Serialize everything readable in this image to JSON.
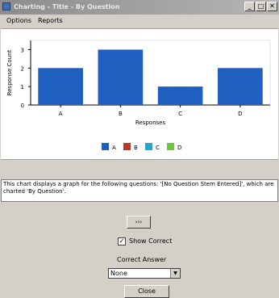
{
  "window": {
    "title": "Charting - Title - By Question",
    "buttons": {
      "minimize": "_",
      "maximize": "□",
      "close": "✕"
    }
  },
  "menubar": {
    "items": [
      "Options",
      "Reports"
    ]
  },
  "chart_data": {
    "type": "bar",
    "categories": [
      "A",
      "B",
      "C",
      "D"
    ],
    "values": [
      2,
      3,
      1,
      2
    ],
    "xlabel": "Responses",
    "ylabel": "Response Count",
    "yticks": [
      0,
      1,
      2,
      3
    ],
    "ylim": [
      0,
      3.5
    ],
    "grid": false,
    "legend": {
      "placement": "bottom",
      "entries": [
        {
          "label": "A",
          "color": "#1f5fbf"
        },
        {
          "label": "B",
          "color": "#c8321e"
        },
        {
          "label": "C",
          "color": "#2aa4c8"
        },
        {
          "label": "D",
          "color": "#6cc832"
        }
      ]
    },
    "bar_color": "#1f5fbf"
  },
  "description": "This chart displays a graph for the following questions: '[No Question Stem Entered]', which are charted 'By Question'.",
  "controls": {
    "expand_label": "›››",
    "show_correct_label": "Show Correct",
    "show_correct_checked": true,
    "check_mark": "✓",
    "correct_answer_label": "Correct Answer",
    "answer_select_value": "None",
    "dropdown_glyph": "▼",
    "close_label": "Close"
  }
}
